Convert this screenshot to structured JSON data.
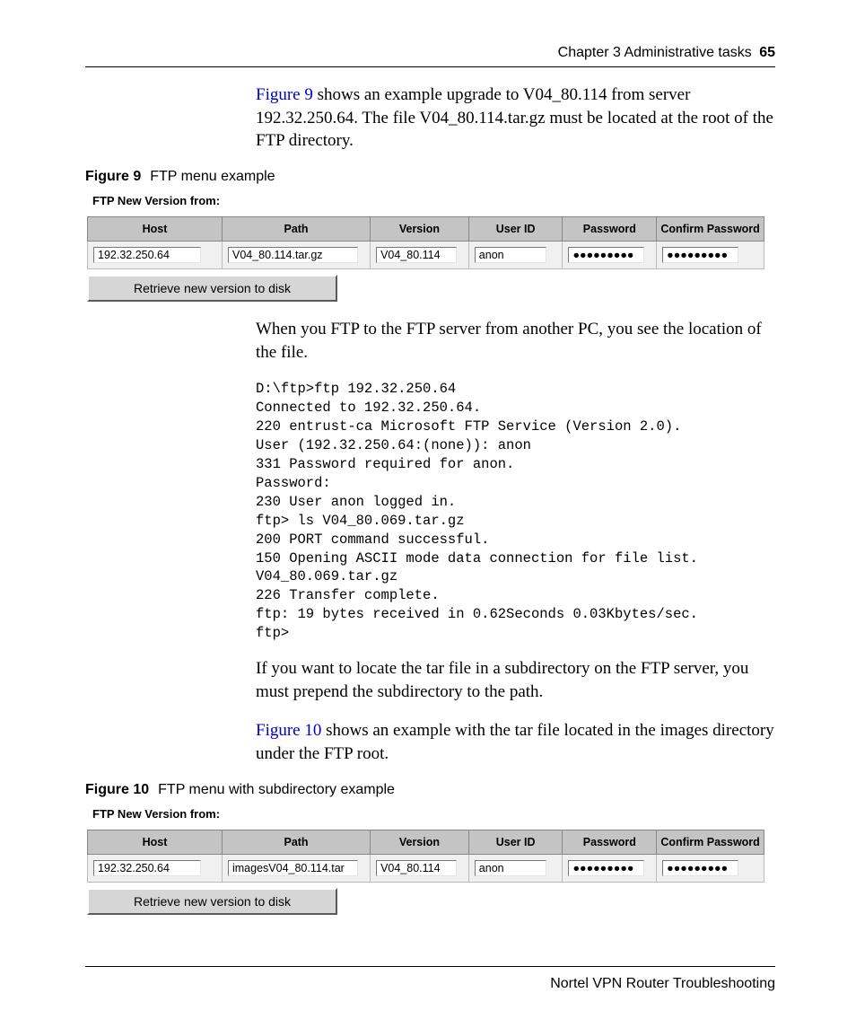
{
  "header": {
    "chapter": "Chapter 3  Administrative tasks",
    "page": "65"
  },
  "para1": {
    "link": "Figure 9",
    "rest": " shows an example upgrade to V04_80.114 from server 192.32.250.64. The file V04_80.114.tar.gz must be located at the root of the FTP directory."
  },
  "fig9": {
    "label": "Figure 9",
    "title": "FTP menu example"
  },
  "ftp_heading": "FTP New Version from:",
  "cols": {
    "host": "Host",
    "path": "Path",
    "version": "Version",
    "user": "User ID",
    "pass": "Password",
    "conf": "Confirm Password"
  },
  "fig9_row": {
    "host": "192.32.250.64",
    "path": "V04_80.114.tar.gz",
    "version": "V04_80.114",
    "user": "anon",
    "pass": "●●●●●●●●●",
    "conf": "●●●●●●●●●"
  },
  "retrieve_label": "Retrieve new version to disk",
  "para2": "When you FTP to the FTP server from another PC, you see the location of the file.",
  "code": "D:\\ftp>ftp 192.32.250.64\nConnected to 192.32.250.64.\n220 entrust-ca Microsoft FTP Service (Version 2.0).\nUser (192.32.250.64:(none)): anon\n331 Password required for anon.\nPassword:\n230 User anon logged in.\nftp> ls V04_80.069.tar.gz\n200 PORT command successful.\n150 Opening ASCII mode data connection for file list.\nV04_80.069.tar.gz\n226 Transfer complete.\nftp: 19 bytes received in 0.62Seconds 0.03Kbytes/sec.\nftp>",
  "para3": "If you want to locate the tar file in a subdirectory on the FTP server, you must prepend the subdirectory to the path.",
  "para4": {
    "link": "Figure 10",
    "rest": " shows an example with the tar file located in the images directory under the FTP root."
  },
  "fig10": {
    "label": "Figure 10",
    "title": "FTP menu with subdirectory example"
  },
  "fig10_row": {
    "host": "192.32.250.64",
    "path": "imagesV04_80.114.tar",
    "version": "V04_80.114",
    "user": "anon",
    "pass": "●●●●●●●●●",
    "conf": "●●●●●●●●●"
  },
  "footer": "Nortel VPN Router Troubleshooting"
}
